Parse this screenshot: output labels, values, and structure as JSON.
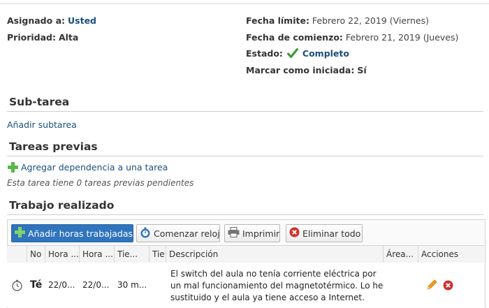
{
  "details": {
    "assigned_label": "Asignado a:",
    "assigned_value": "Usted",
    "priority_label": "Prioridad:",
    "priority_value": "Alta",
    "due_label": "Fecha límite:",
    "due_value": "Febrero 22, 2019 (Viernes)",
    "start_label": "Fecha de comienzo:",
    "start_value": "Febrero 21, 2019 (Jueves)",
    "status_label": "Estado:",
    "status_value": "Completo",
    "started_label": "Marcar como iniciada:",
    "started_value": "Sí"
  },
  "subtask": {
    "title": "Sub-tarea",
    "add_link": "Añadir subtarea"
  },
  "previous": {
    "title": "Tareas previas",
    "add_link": "Agregar dependencia a una tarea",
    "note": "Esta tarea tiene 0 tareas previas pendientes"
  },
  "work": {
    "title": "Trabajo realizado",
    "toolbar": {
      "add_hours": "Añadir horas trabajadas",
      "start_clock": "Comenzar reloj",
      "print": "Imprimir",
      "delete_all": "Eliminar todo"
    },
    "columns": [
      "No",
      "Hora ...",
      "Hora ...",
      "Tie...",
      "Tie",
      "Descripción",
      "Área...",
      "Acciones"
    ],
    "rows": [
      {
        "name": "Té",
        "start": "22/0...",
        "end": "22/0...",
        "time": "30 m...",
        "description": "El switch del aula no tenía corriente eléctrica por un mal funcionamiento del magnetotérmico. Lo he sustituido y el aula ya tiene acceso a Internet."
      }
    ]
  },
  "icons": {
    "check": "check-icon",
    "plus": "plus-icon",
    "clock": "stopwatch-icon",
    "printer": "printer-icon",
    "delete": "delete-icon",
    "edit": "pencil-icon"
  },
  "colors": {
    "link": "#1b4f7d",
    "primary_button": "#2f74bd",
    "check_green": "#3a9a2f",
    "plus_green": "#58b947",
    "delete_red": "#d0312d",
    "edit_orange": "#f0a020"
  }
}
